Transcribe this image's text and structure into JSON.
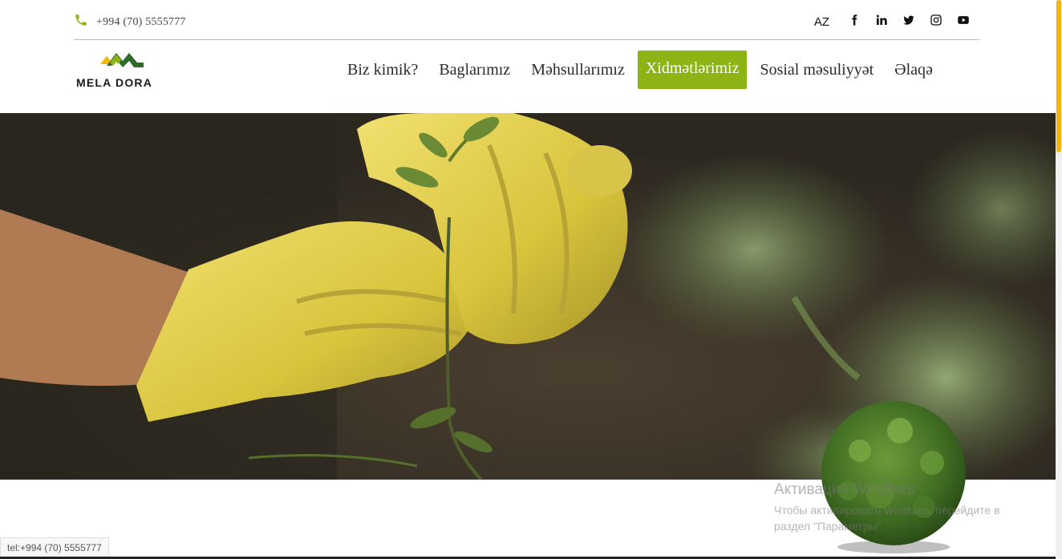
{
  "header": {
    "phone": "+994 (70) 5555777",
    "language": "AZ",
    "social_icons": [
      "facebook-icon",
      "linkedin-icon",
      "twitter-icon",
      "instagram-icon",
      "youtube-icon"
    ]
  },
  "brand": {
    "name": "MELA DORA",
    "accent_color": "#8db414",
    "logo_colors": [
      "#f2b705",
      "#8db414",
      "#2e6b2a"
    ]
  },
  "nav": {
    "items": [
      {
        "label": "Biz kimik?"
      },
      {
        "label": "Baglarımız"
      },
      {
        "label": "Məhsullarımız"
      },
      {
        "label": "Xidmətlərimiz",
        "active": true
      },
      {
        "label": "Sosial məsuliyyət"
      },
      {
        "label": "Əlaqə"
      }
    ]
  },
  "hero": {
    "image": "hands in yellow gloves holding a seedling"
  },
  "status_bar": {
    "url": "tel:+994 (70) 5555777"
  },
  "watermark": {
    "title": "Активация Windows",
    "subtitle": "Чтобы активировать Windows, перейдите в раздел \"Параметры\"."
  }
}
